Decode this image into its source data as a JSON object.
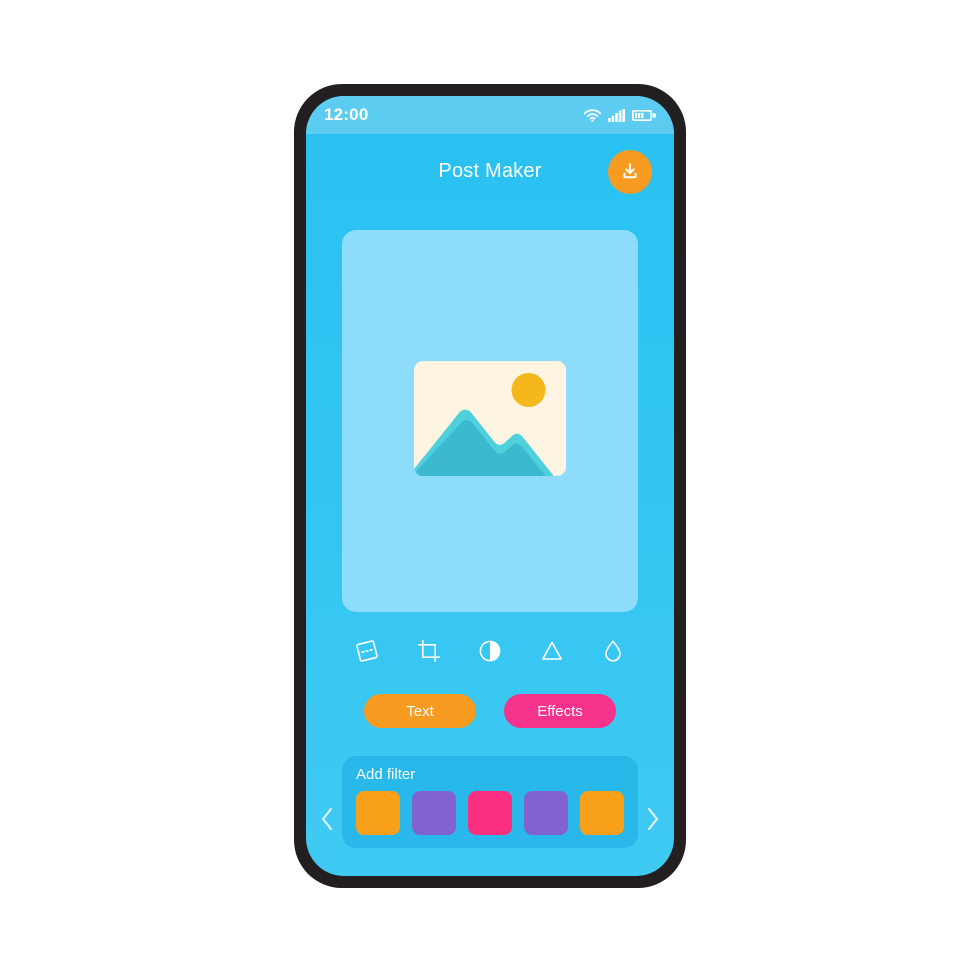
{
  "status_bar": {
    "time": "12:00",
    "icons": [
      {
        "name": "wifi-icon",
        "label": "wifi"
      },
      {
        "name": "cellular-signal-icon",
        "label": "signal"
      },
      {
        "name": "battery-icon",
        "label": "battery"
      }
    ]
  },
  "header": {
    "title": "Post Maker",
    "download_button": {
      "name": "download-button",
      "icon": "download-icon",
      "color": "#f79c21"
    }
  },
  "preview": {
    "card_color": "#8ddcfb",
    "image_placeholder": {
      "icon": "image-placeholder-icon",
      "frame_color": "#fdf4e2",
      "mountain_color": "#3cb9cf",
      "mountain_light_color": "#4ed0dd",
      "sun_color": "#f5b81c"
    }
  },
  "tools": [
    {
      "name": "perspective-tool-icon",
      "label": "Perspective"
    },
    {
      "name": "crop-tool-icon",
      "label": "Crop"
    },
    {
      "name": "contrast-tool-icon",
      "label": "Contrast"
    },
    {
      "name": "sharpen-tool-icon",
      "label": "Sharpen"
    },
    {
      "name": "blur-tool-icon",
      "label": "Blur"
    }
  ],
  "actions": {
    "text_label": "Text",
    "text_color": "#f79c21",
    "effects_label": "Effects",
    "effects_color": "#f5338c"
  },
  "filters": {
    "title": "Add filter",
    "prev_arrow": "chevron-left-icon",
    "next_arrow": "chevron-right-icon",
    "swatches": [
      {
        "name": "filter-swatch-1",
        "color": "#f9a01b"
      },
      {
        "name": "filter-swatch-2",
        "color": "#8163cf"
      },
      {
        "name": "filter-swatch-3",
        "color": "#fb2f7f"
      },
      {
        "name": "filter-swatch-4",
        "color": "#8163cf"
      },
      {
        "name": "filter-swatch-5",
        "color": "#f9a01b"
      }
    ]
  },
  "theme": {
    "screen_top": "#29c0f0",
    "screen_bottom": "#3fcaf3",
    "status_bar": "#5ccdf1",
    "frame": "#231f20",
    "white": "#ffffff"
  }
}
